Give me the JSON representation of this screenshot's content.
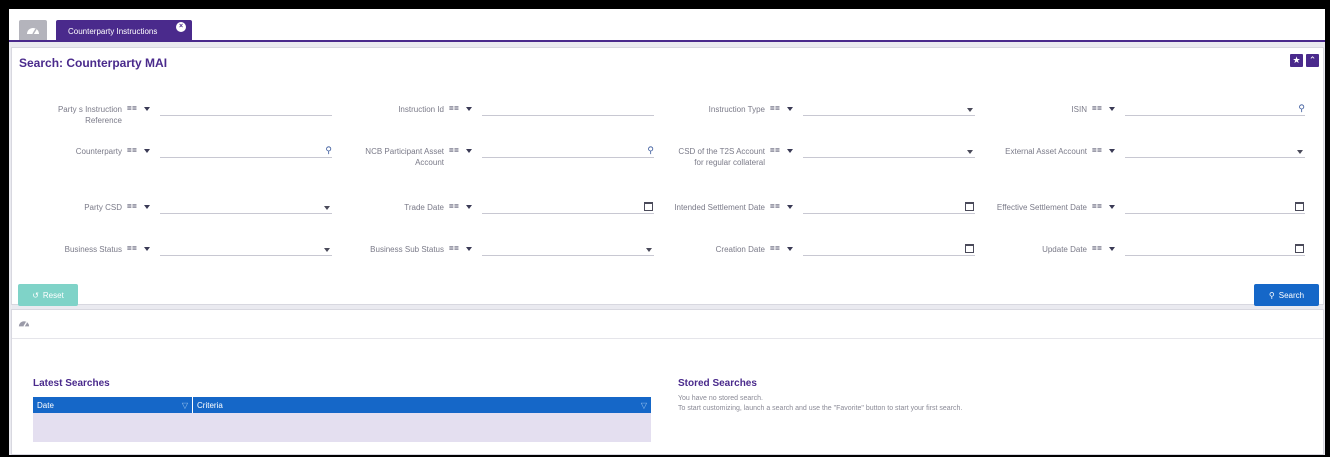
{
  "tabs": {
    "home_icon": "dashboard-icon",
    "active_label": "Counterparty Instructions"
  },
  "panel": {
    "title": "Search: Counterparty MAI"
  },
  "operator": "== ",
  "fields": [
    {
      "label": "Party s Instruction Reference",
      "icon": "none"
    },
    {
      "label": "Instruction Id",
      "icon": "none"
    },
    {
      "label": "Instruction Type",
      "icon": "dropdown"
    },
    {
      "label": "ISIN",
      "icon": "search"
    },
    {
      "label": "Counterparty",
      "icon": "search"
    },
    {
      "label": "NCB Participant Asset Account",
      "icon": "search"
    },
    {
      "label": "CSD of the T2S Account for regular collateral",
      "icon": "dropdown"
    },
    {
      "label": "External Asset Account",
      "icon": "dropdown"
    },
    {
      "label": "Party CSD",
      "icon": "dropdown"
    },
    {
      "label": "Trade Date",
      "icon": "calendar"
    },
    {
      "label": "Intended Settlement Date",
      "icon": "calendar"
    },
    {
      "label": "Effective Settlement Date",
      "icon": "calendar"
    },
    {
      "label": "Business Status",
      "icon": "dropdown"
    },
    {
      "label": "Business Sub Status",
      "icon": "dropdown"
    },
    {
      "label": "Creation Date",
      "icon": "calendar"
    },
    {
      "label": "Update Date",
      "icon": "calendar"
    }
  ],
  "buttons": {
    "reset": "Reset",
    "search": "Search"
  },
  "latest": {
    "title": "Latest Searches",
    "columns": [
      "Date",
      "Criteria"
    ]
  },
  "stored": {
    "title": "Stored Searches",
    "line1": "You have no stored search.",
    "line2": "To start customizing, launch a search and use the \"Favorite\" button to start your first search."
  },
  "colors": {
    "primary": "#4a2a8c",
    "action": "#1567c8",
    "reset": "#7fd3c8"
  }
}
